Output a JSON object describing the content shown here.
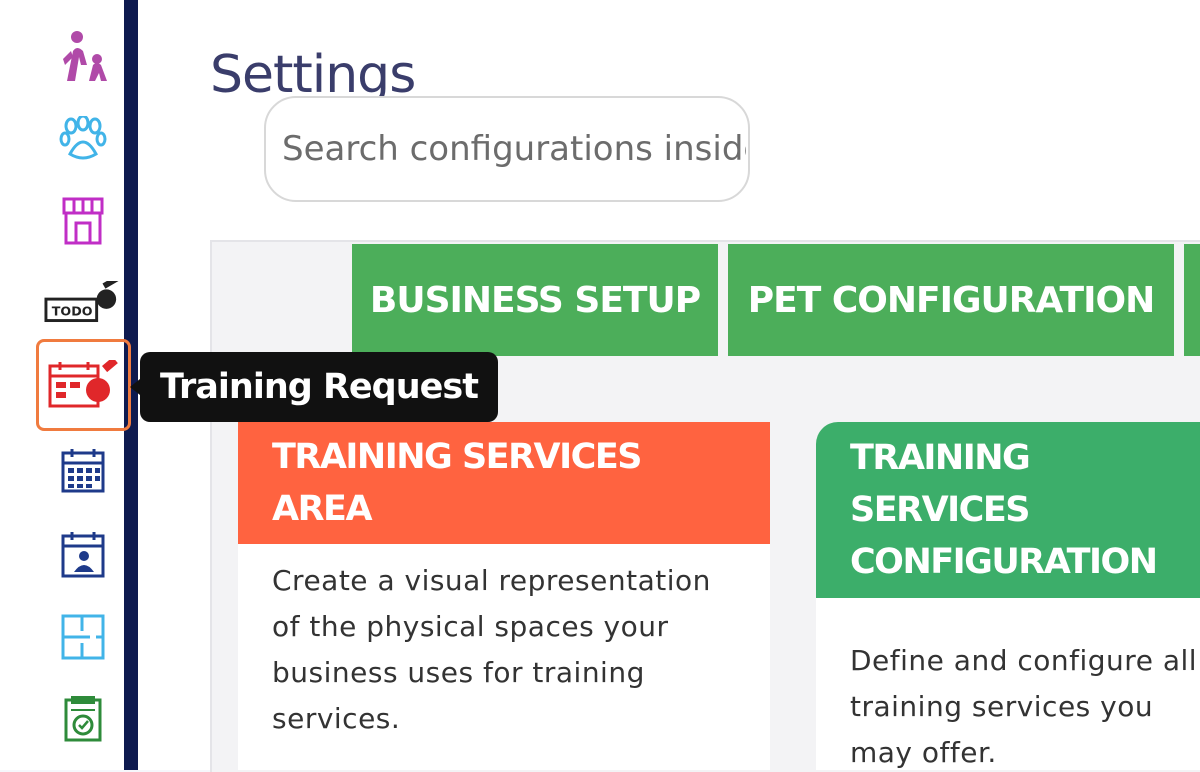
{
  "page": {
    "title": "Settings"
  },
  "search": {
    "placeholder": "Search configurations inside"
  },
  "tabs": [
    {
      "label": "BUSINESS SETUP"
    },
    {
      "label": "PET CONFIGURATION"
    }
  ],
  "tooltip": {
    "text": "Training Request"
  },
  "sidebar": {
    "items": [
      {
        "icon": "pets-people-icon",
        "color": "#b04aa8"
      },
      {
        "icon": "paw-icon",
        "color": "#41b4e8"
      },
      {
        "icon": "store-icon",
        "color": "#c02ec6"
      },
      {
        "icon": "whistle-todo-icon",
        "color": "#222222"
      },
      {
        "icon": "training-request-icon",
        "color": "#e0272a"
      },
      {
        "icon": "calendar-icon",
        "color": "#1e3a8a"
      },
      {
        "icon": "calendar-user-icon",
        "color": "#1e3a8a"
      },
      {
        "icon": "floorplan-icon",
        "color": "#41b4e8"
      },
      {
        "icon": "checklist-clock-icon",
        "color": "#2e8b3a"
      }
    ]
  },
  "cards": [
    {
      "title": "TRAINING SERVICES AREA",
      "body": "Create a visual representation of the physical spaces your business uses for training services.",
      "color": "#ff6340"
    },
    {
      "title": "TRAINING SERVICES CONFIGURATION",
      "body": "Define and configure all training services you may offer.",
      "color": "#3cae6a"
    }
  ]
}
